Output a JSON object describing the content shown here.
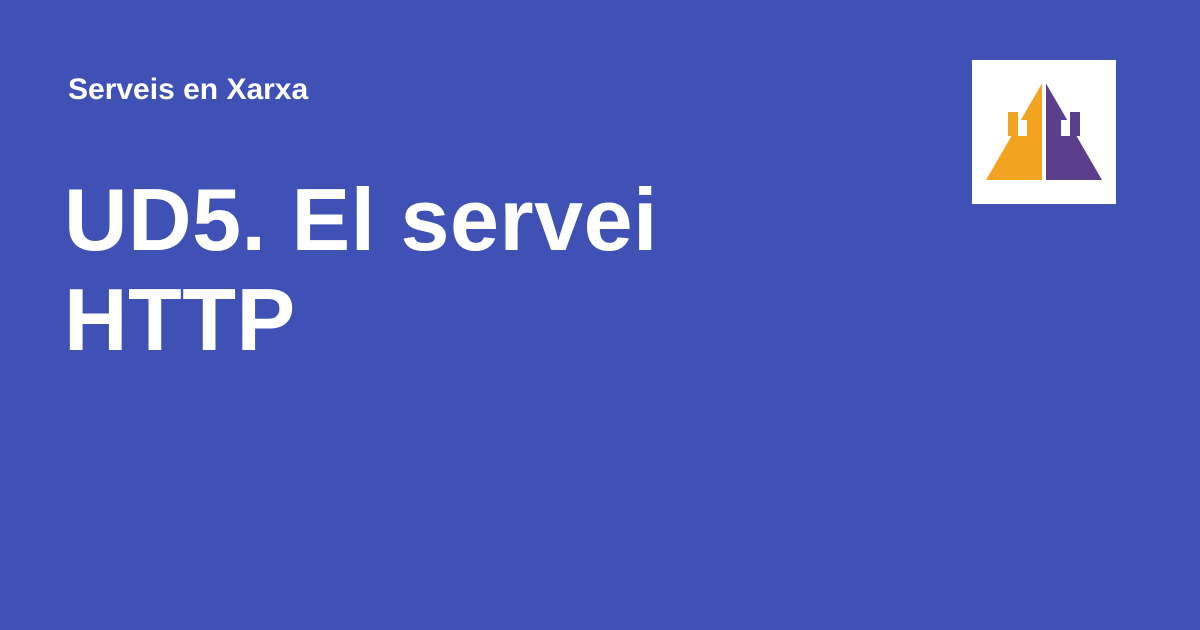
{
  "header": {
    "site_name": "Serveis en Xarxa"
  },
  "main": {
    "title": "UD5. El servei HTTP"
  },
  "logo": {
    "icon": "pyramid-logo-icon",
    "colors": {
      "left": "#f2a31f",
      "right": "#5b3f8c",
      "background": "#ffffff"
    }
  },
  "theme": {
    "background": "#3f51b5",
    "text": "#ffffff"
  }
}
